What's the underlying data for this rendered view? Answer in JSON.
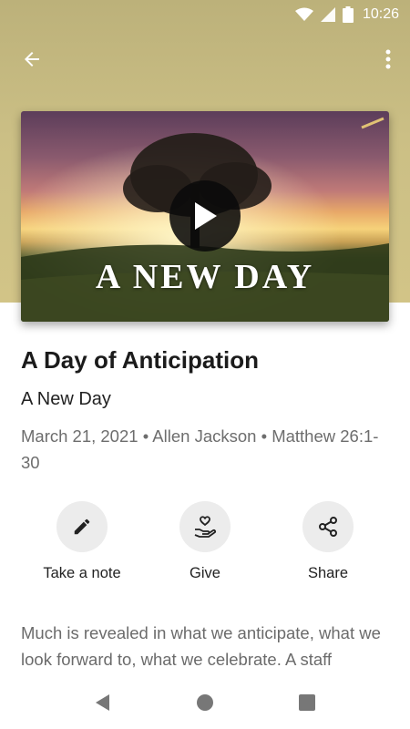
{
  "status_bar": {
    "time": "10:26",
    "icons": [
      "wifi-icon",
      "signal-icon",
      "battery-icon"
    ]
  },
  "app_bar": {
    "back_icon": "arrow-back-icon",
    "more_icon": "more-vertical-icon"
  },
  "video": {
    "overlay_title": "A NEW DAY",
    "play_icon": "play-icon"
  },
  "sermon": {
    "title": "A Day of Anticipation",
    "series": "A New Day",
    "meta": "March 21, 2021 • Allen Jackson • Matthew 26:1-30"
  },
  "actions": [
    {
      "label": "Take a note",
      "icon": "pencil-icon"
    },
    {
      "label": "Give",
      "icon": "hand-heart-icon"
    },
    {
      "label": "Share",
      "icon": "share-icon"
    }
  ],
  "description": "Much is revealed in what we anticipate, what we look forward to, what we celebrate. A staff",
  "nav_bar": {
    "icons": [
      "nav-back-icon",
      "nav-home-icon",
      "nav-recents-icon"
    ]
  },
  "colors": {
    "hero_background": "#c9bd84",
    "action_circle": "#ececec",
    "meta_text": "#6d6d6d"
  }
}
